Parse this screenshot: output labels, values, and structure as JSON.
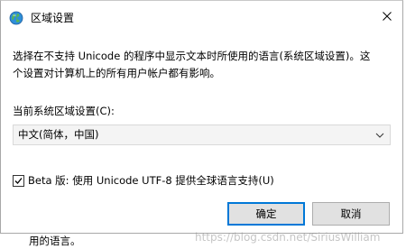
{
  "window": {
    "title": "区域设置",
    "title_icon": "globe-icon",
    "close_icon": "close-icon"
  },
  "description": {
    "line1": "选择在不支持 Unicode 的程序中显示文本时所使用的语言(系统区域设置)。这",
    "line2": "个设置对计算机上的所有用户帐户都有影响。"
  },
  "locale": {
    "label": "当前系统区域设置(C):",
    "selected_value": "中文(简体，中国)"
  },
  "utf8_option": {
    "checked": true,
    "label": "Beta 版: 使用 Unicode UTF-8 提供全球语言支持(U)"
  },
  "buttons": {
    "ok_label": "确定",
    "cancel_label": "取消"
  },
  "background_text": "用的语言。",
  "watermark": "https://blog.csdn.net/SiriusWilliam",
  "colors": {
    "accent": "#0078d7",
    "button_bg": "#e1e1e1",
    "select_bg": "#f4f4f4"
  }
}
